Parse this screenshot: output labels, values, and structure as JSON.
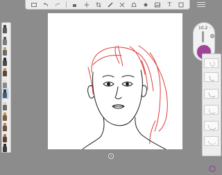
{
  "toolbar": {
    "items": [
      {
        "name": "layout-icon"
      },
      {
        "name": "undo-icon"
      },
      {
        "name": "redo-icon"
      },
      {
        "name": "select-icon"
      },
      {
        "name": "transform-icon"
      },
      {
        "name": "crop-icon"
      },
      {
        "name": "ruler-icon"
      },
      {
        "name": "symmetry-icon"
      },
      {
        "name": "perspective-icon"
      },
      {
        "name": "fill-icon"
      },
      {
        "name": "image-icon"
      },
      {
        "name": "text-icon"
      },
      {
        "name": "fullscreen-icon"
      }
    ],
    "text_glyph": "T"
  },
  "brush_size": {
    "value": "10.2"
  },
  "current_color": {
    "hex": "#a0439a"
  },
  "colors": {
    "canvas_bg": "#ffffff",
    "app_bg": "#8c8c8c",
    "stroke_black": "#1a1a1a",
    "stroke_red": "#e03a3a"
  },
  "layers": {
    "count": 4
  },
  "menu": {
    "label": ""
  }
}
